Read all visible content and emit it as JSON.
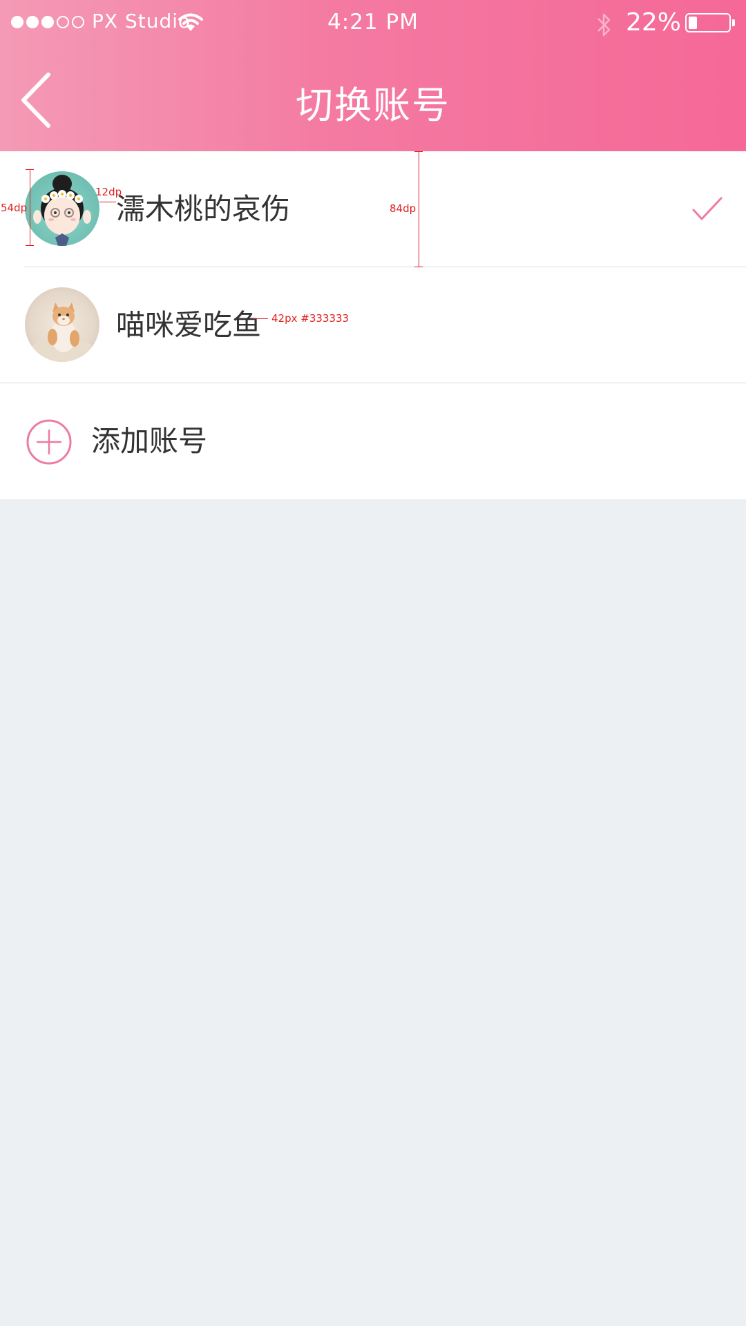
{
  "status_bar": {
    "carrier": "PX Studio",
    "time": "4:21 PM",
    "battery_percent": "22%",
    "battery_level": 0.22,
    "signal_bars_filled": 3,
    "signal_bars_total": 5,
    "icons": [
      "wifi-icon",
      "bluetooth-icon",
      "battery-icon"
    ]
  },
  "nav": {
    "back_icon": "chevron-left-icon",
    "title": "切换账号"
  },
  "accounts": [
    {
      "name": "濡木桃的哀伤",
      "avatar": "girl-with-flower-crown",
      "selected": true
    },
    {
      "name": "喵咪爱吃鱼",
      "avatar": "cat-photo",
      "selected": false
    }
  ],
  "add_account": {
    "icon": "plus-circle-icon",
    "label": "添加账号"
  },
  "annotations": {
    "avatar_size": "54dp",
    "avatar_gap": "12dp",
    "row_height": "84dp",
    "name_font": "42px #333333"
  },
  "colors": {
    "brand_pink": "#f47aa2",
    "accent_pink": "#ee7ba0",
    "text": "#333333",
    "background": "#edf0f2",
    "annotation": "#e02020"
  }
}
